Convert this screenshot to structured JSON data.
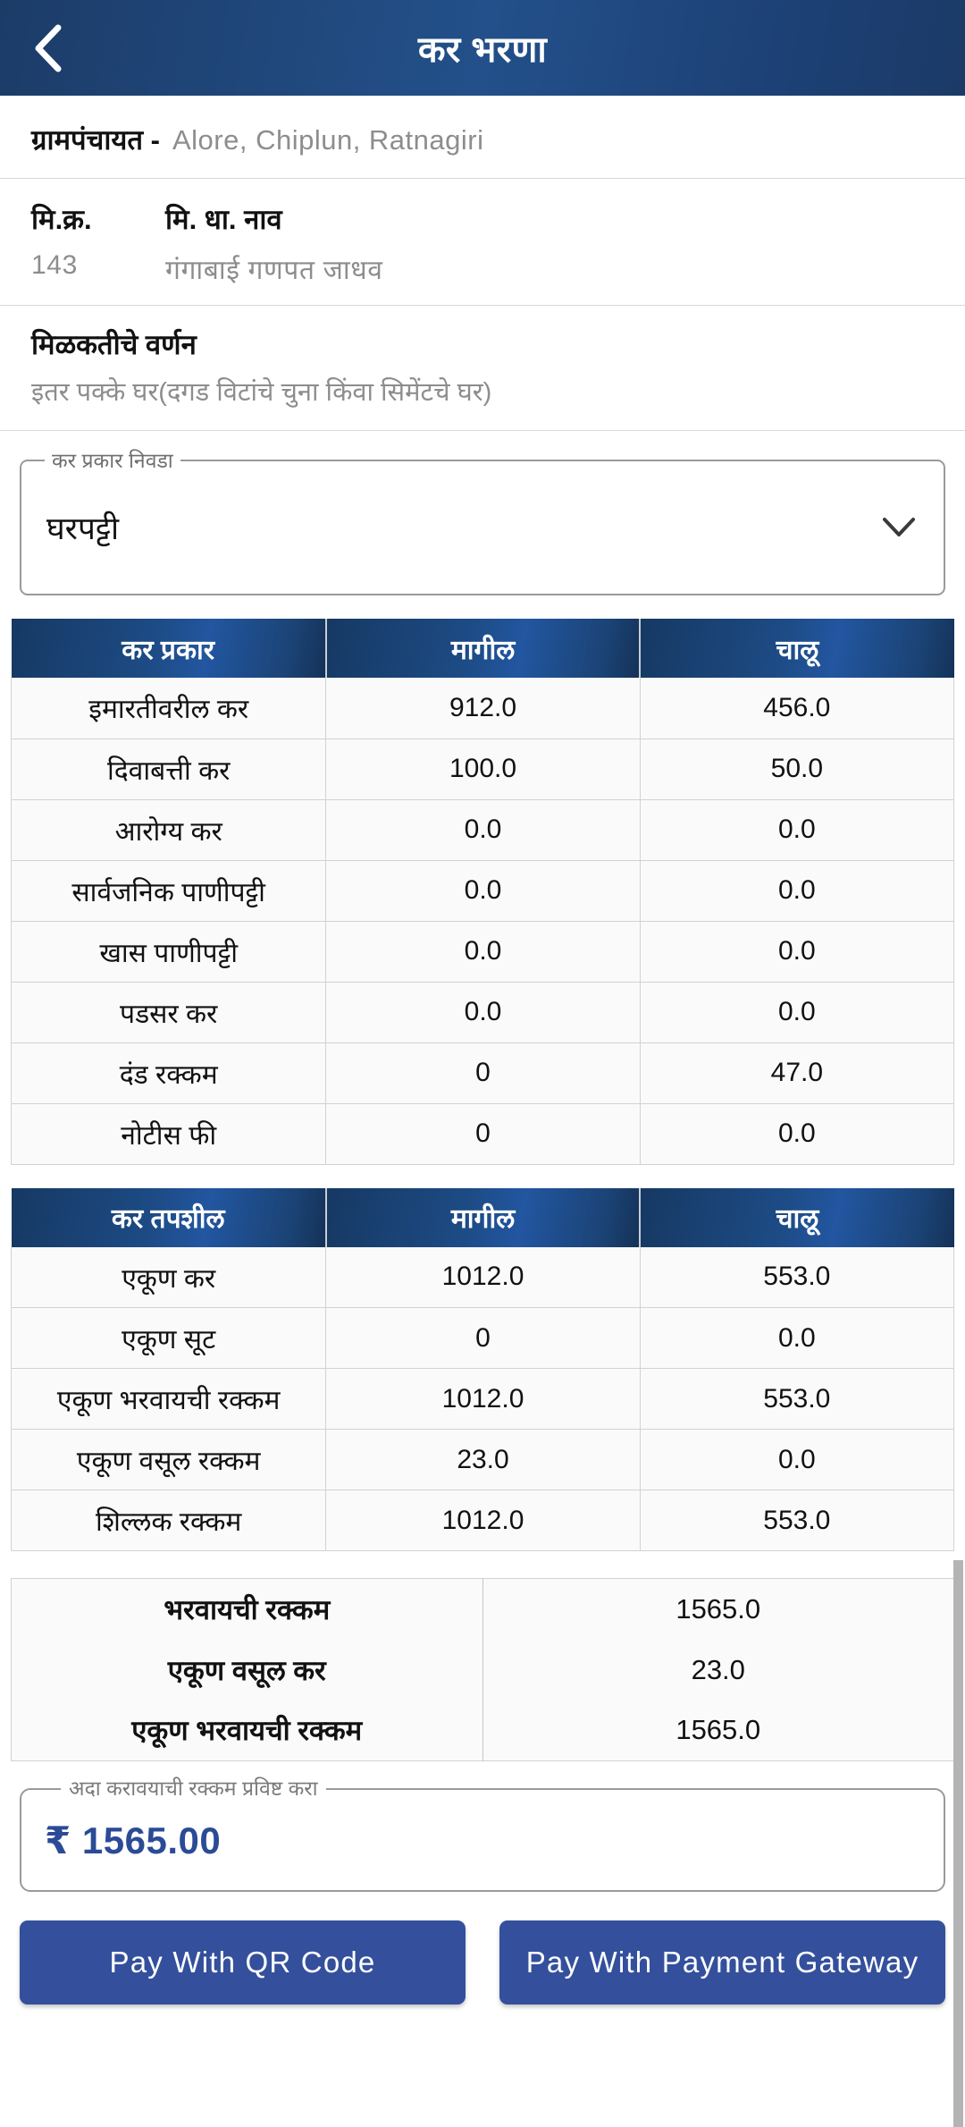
{
  "appbar": {
    "title": "कर भरणा",
    "back_icon": "chevron-left-icon"
  },
  "gram_panchayat": {
    "label": "ग्रामपंचायत -",
    "value": "Alore,  Chiplun,  Ratnagiri"
  },
  "owner": {
    "no_heading": "मि.क्र.",
    "no_value": "143",
    "name_heading": "मि. धा. नाव",
    "name_value": "गंगाबाई  गणपत  जाधव"
  },
  "description": {
    "heading": "मिळकतीचे वर्णन",
    "value": "इतर पक्के घर(दगड विटांचे चुना किंवा सिमेंटचे घर)"
  },
  "tax_type_select": {
    "legend": "कर प्रकार निवडा",
    "value": "घरपट्टी",
    "arrow_icon": "chevron-down-icon"
  },
  "tax_table": {
    "headers": [
      "कर प्रकार",
      "मागील",
      "चालू"
    ],
    "rows": [
      {
        "name": "इमारतीवरील कर",
        "previous": "912.0",
        "current": "456.0"
      },
      {
        "name": "दिवाबत्ती कर",
        "previous": "100.0",
        "current": "50.0"
      },
      {
        "name": "आरोग्य कर",
        "previous": "0.0",
        "current": "0.0"
      },
      {
        "name": "सार्वजनिक पाणीपट्टी",
        "previous": "0.0",
        "current": "0.0"
      },
      {
        "name": "खास पाणीपट्टी",
        "previous": "0.0",
        "current": "0.0"
      },
      {
        "name": "पडसर कर",
        "previous": "0.0",
        "current": "0.0"
      },
      {
        "name": "दंड रक्कम",
        "previous": "0",
        "current": "47.0"
      },
      {
        "name": "नोटीस फी",
        "previous": "0",
        "current": "0.0"
      }
    ]
  },
  "detail_table": {
    "headers": [
      "कर तपशील",
      "मागील",
      "चालू"
    ],
    "rows": [
      {
        "name": "एकूण कर",
        "previous": "1012.0",
        "current": "553.0"
      },
      {
        "name": "एकूण सूट",
        "previous": "0",
        "current": "0.0"
      },
      {
        "name": "एकूण भरवायची रक्कम",
        "previous": "1012.0",
        "current": "553.0"
      },
      {
        "name": "एकूण वसूल रक्कम",
        "previous": "23.0",
        "current": "0.0"
      },
      {
        "name": "शिल्लक रक्कम",
        "previous": "1012.0",
        "current": "553.0"
      }
    ]
  },
  "summary": {
    "rows": [
      {
        "label": "भरवायची रक्कम",
        "value": "1565.0"
      },
      {
        "label": "एकूण वसूल कर",
        "value": "23.0"
      },
      {
        "label": "एकूण भरवायची रक्कम",
        "value": "1565.0"
      }
    ]
  },
  "amount_field": {
    "legend": "अदा करावयाची रक्कम प्रविष्ट करा",
    "value": "₹ 1565.00"
  },
  "buttons": {
    "qr": "Pay With QR Code",
    "gateway": "Pay With Payment Gateway"
  },
  "colors": {
    "appbar_blue": "#1d4176",
    "table_header_blue": "#1d4b85",
    "button_blue": "#34509c",
    "amount_blue": "#2b4b96",
    "muted_text": "#8d8d8d",
    "scrollbar": "#b4b4b4"
  }
}
